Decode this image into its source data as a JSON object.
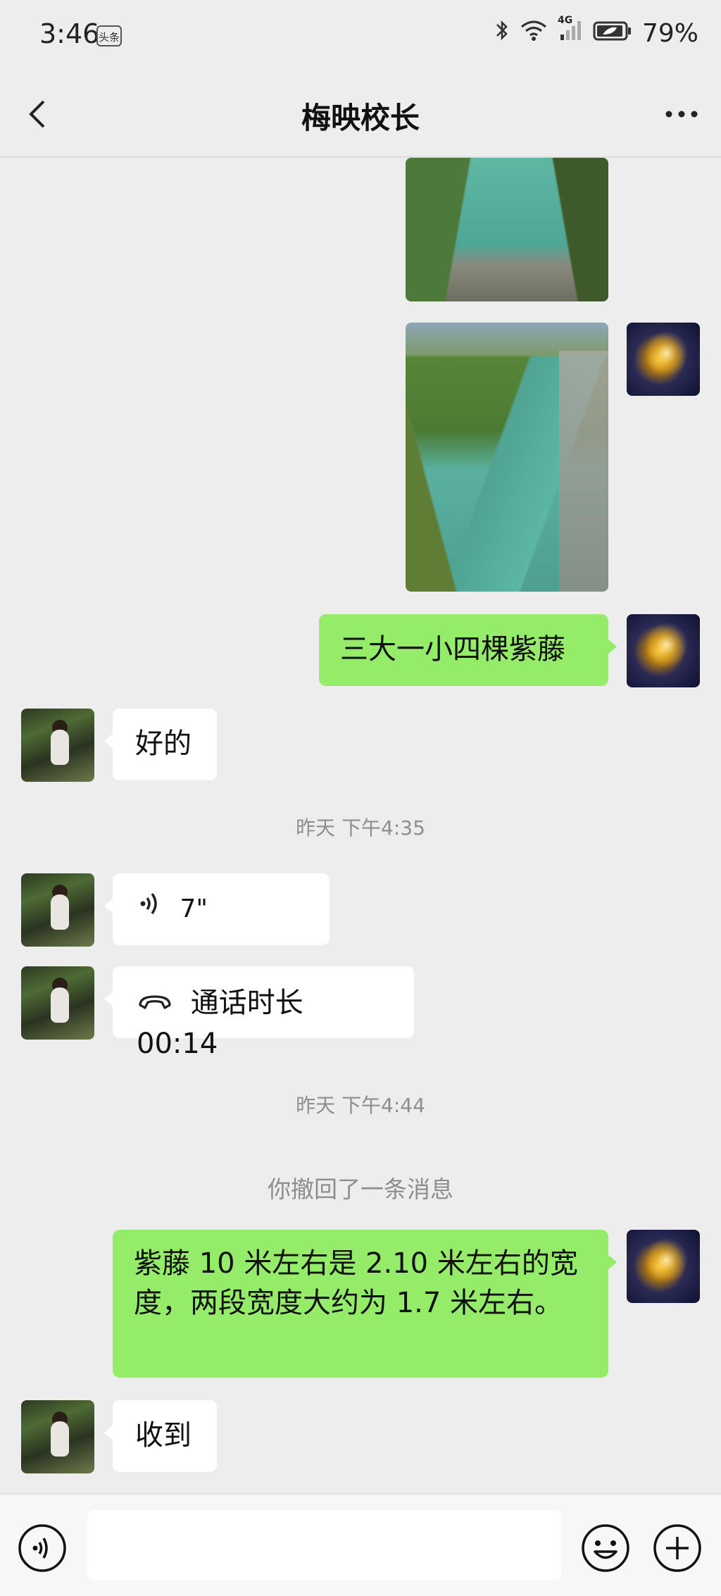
{
  "status_bar": {
    "time": "3:46",
    "badge": "头条",
    "network": "4G",
    "battery": "79%"
  },
  "header": {
    "title": "梅映校长"
  },
  "messages": {
    "m1_text": "三大一小四棵紫藤",
    "m2_text": "好的",
    "ts1": "昨天 下午4:35",
    "voice_duration": "7\"",
    "call_text": "通话时长 00:14",
    "ts2": "昨天 下午4:44",
    "recall_notice": "你撤回了一条消息",
    "m3_text": "紫藤 10 米左右是 2.10 米左右的宽度，两段宽度大约为 1.7 米左右。",
    "m4_text": "收到"
  },
  "colors": {
    "outgoing_bubble": "#95ec69",
    "incoming_bubble": "#ffffff",
    "background": "#ededed"
  }
}
